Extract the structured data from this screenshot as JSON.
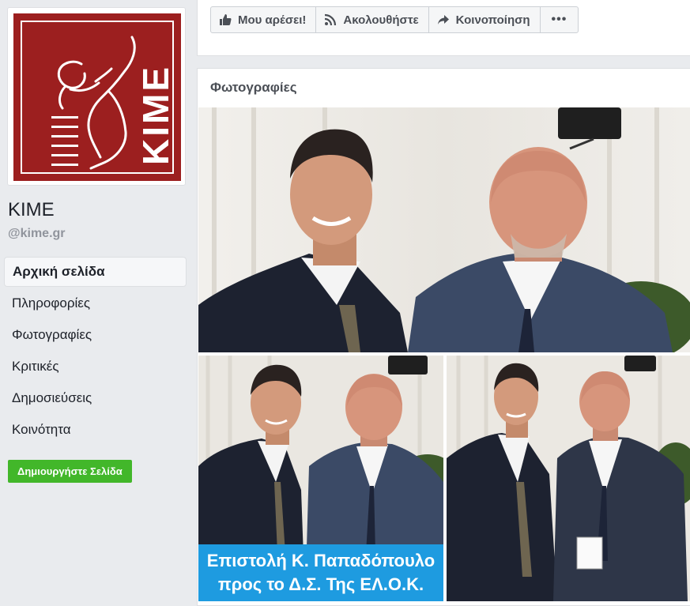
{
  "sidebar": {
    "logo_text": "KIME",
    "page_name": "KIME",
    "page_handle": "@kime.gr",
    "nav": [
      {
        "label": "Αρχική σελίδα",
        "active": true
      },
      {
        "label": "Πληροφορίες",
        "active": false
      },
      {
        "label": "Φωτογραφίες",
        "active": false
      },
      {
        "label": "Κριτικές",
        "active": false
      },
      {
        "label": "Δημοσιεύσεις",
        "active": false
      },
      {
        "label": "Κοινότητα",
        "active": false
      }
    ],
    "create_page_label": "Δημιουργήστε Σελίδα"
  },
  "actions": {
    "like_label": "Μου αρέσει!",
    "follow_label": "Ακολουθήστε",
    "share_label": "Κοινοποίηση",
    "more_label": "•••"
  },
  "photos": {
    "title": "Φωτογραφίες",
    "caption_line1": "Επιστολή Κ. Παπαδόπουλο",
    "caption_line2": "προς το Δ.Σ. Της ΕΛ.Ο.Κ."
  },
  "colors": {
    "brand_red": "#9c1f1f",
    "green_button": "#42b72a",
    "caption_blue": "#1e9be0"
  }
}
